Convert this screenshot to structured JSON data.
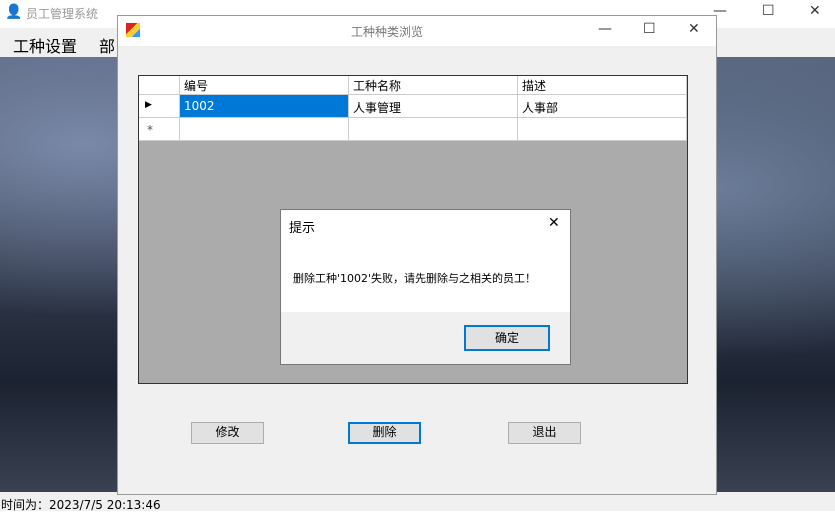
{
  "main_window": {
    "title": "员工管理系统",
    "menu": [
      "工种设置",
      "部"
    ],
    "controls": {
      "minimize": "—",
      "maximize": "☐",
      "close": "✕"
    }
  },
  "status_bar": {
    "text": "时间为：2023/7/5 20:13:46"
  },
  "child_window": {
    "title": "工种种类浏览",
    "grid": {
      "columns": [
        "编号",
        "工种名称",
        "描述"
      ],
      "rows": [
        [
          "1002",
          "人事管理",
          "人事部"
        ]
      ],
      "current_row_marker": "▶",
      "new_row_marker": "*"
    },
    "buttons": {
      "edit": "修改",
      "delete": "删除",
      "exit": "退出"
    }
  },
  "dialog": {
    "title": "提示",
    "message": "删除工种'1002'失败，请先删除与之相关的员工！",
    "ok": "确定",
    "close": "✕"
  },
  "colors": {
    "selection": "#0078d7",
    "accent": "#0078d7"
  }
}
